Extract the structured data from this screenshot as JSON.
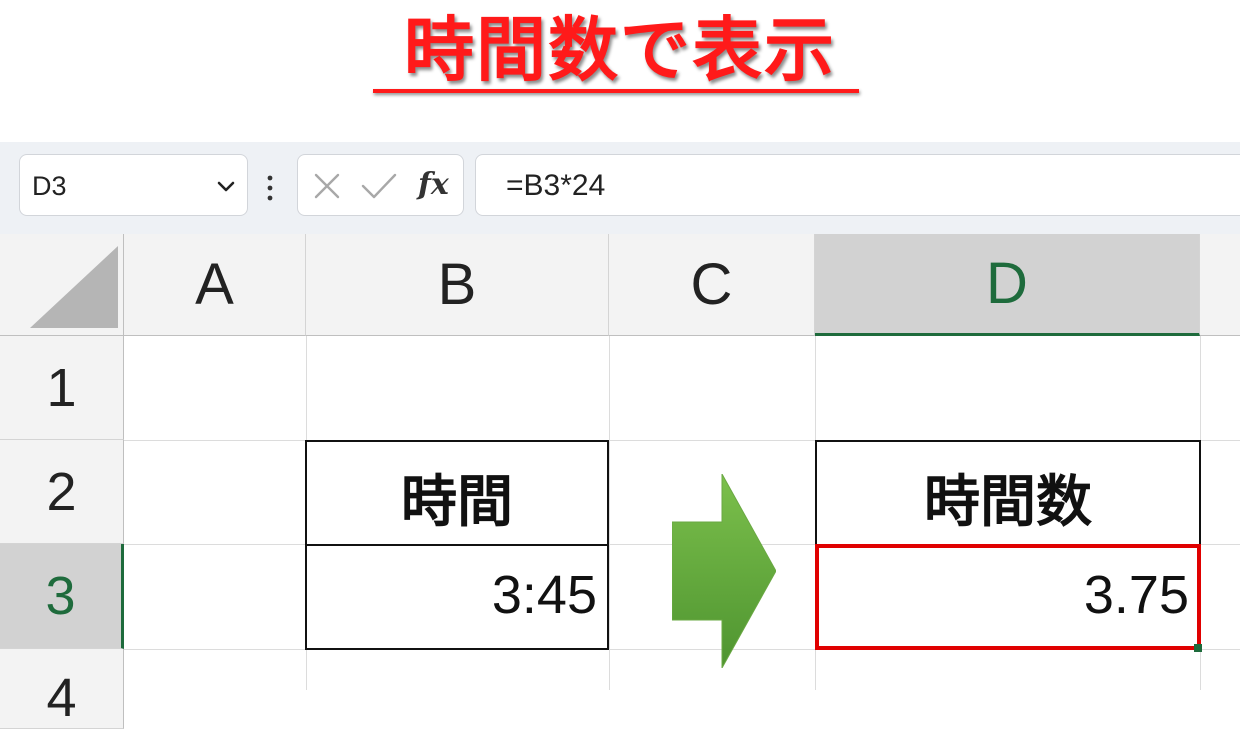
{
  "banner": {
    "title": "時間数で表示"
  },
  "formula_bar": {
    "name_box": "D3",
    "cancel_icon": "close-icon",
    "enter_icon": "check-icon",
    "fx_label": "fx",
    "formula": "=B3*24"
  },
  "sheet": {
    "columns": [
      "A",
      "B",
      "C",
      "D"
    ],
    "rows": [
      "1",
      "2",
      "3",
      "4"
    ],
    "selected_column": "D",
    "selected_row": "3",
    "cells": {
      "B2": "時間",
      "B3": "3:45",
      "D2": "時間数",
      "D3": "3.75"
    },
    "arrow_icon": "right-arrow-icon",
    "colors": {
      "accent_red": "#e00000",
      "title_red": "#ff1a1a",
      "excel_green": "#1e6b3c",
      "arrow_green": "#5fa83a"
    }
  }
}
